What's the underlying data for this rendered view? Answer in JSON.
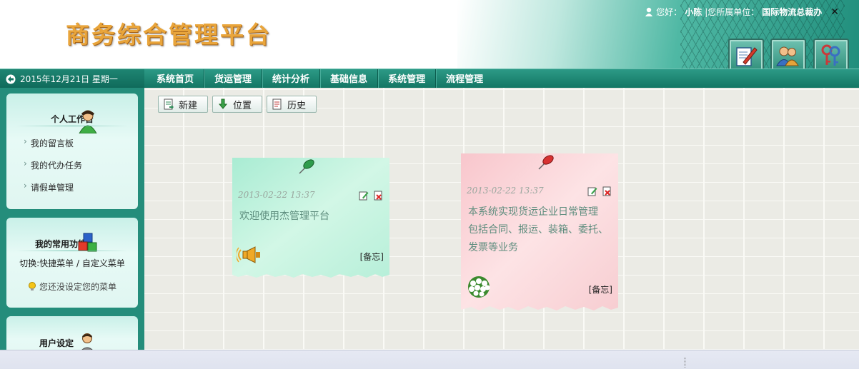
{
  "header": {
    "title": "商务综合管理平台",
    "greeting_prefix": "您好：",
    "user_name": "小陈",
    "unit_prefix": "|您所属单位：",
    "unit_name": "国际物流总裁办",
    "close_symbol": "✕",
    "buttons": [
      {
        "icon": "edit-document-icon"
      },
      {
        "icon": "users-icon"
      },
      {
        "icon": "keys-icon"
      }
    ]
  },
  "navbar": {
    "date": "2015年12月21日 星期一",
    "menu": [
      "系统首页",
      "货运管理",
      "统计分析",
      "基础信息",
      "系统管理",
      "流程管理"
    ]
  },
  "sidebar": {
    "workspace": {
      "title": "个人工作台",
      "links": [
        "我的留言板",
        "我的代办任务",
        "请假单管理"
      ]
    },
    "favorites": {
      "title": "我的常用功能",
      "switch_text": "切换:快捷菜单 / 自定义菜单",
      "hint": "您还没设定您的菜单"
    },
    "settings": {
      "title": "用户设定"
    }
  },
  "toolbar": {
    "new_label": "新建",
    "position_label": "位置",
    "history_label": "历史"
  },
  "notes": [
    {
      "date": "2013-02-22 13:37",
      "text": "欢迎使用杰管理平台",
      "tag": "[备忘]",
      "color": "#c8f4e2",
      "pin_color": "#2e9c4c",
      "icon": "speaker-icon"
    },
    {
      "date": "2013-02-22 13:37",
      "text": "本系统实现货运企业日常管理\n包括合同、报运、装箱、委托、\n发票等业务",
      "tag": "[备忘]",
      "color": "#fbd9dc",
      "pin_color": "#d83232",
      "icon": "flower-bouquet-icon"
    }
  ],
  "colors": {
    "brand_teal": "#1b8a76",
    "logo_gold": "#e9a53b"
  }
}
